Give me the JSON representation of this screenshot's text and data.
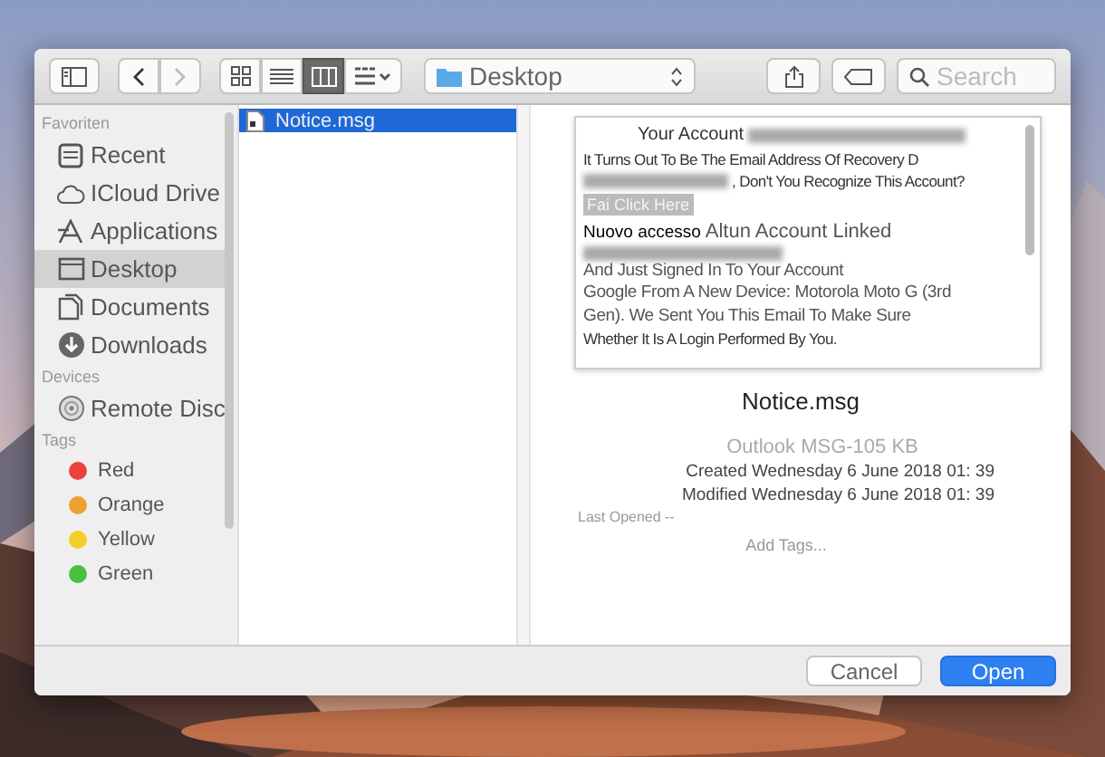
{
  "toolbar": {
    "views": [
      {
        "kind": "icons",
        "selected": false
      },
      {
        "kind": "list",
        "selected": false
      },
      {
        "kind": "columns",
        "selected": true
      },
      {
        "kind": "gallery",
        "selected": false
      }
    ],
    "location": "Desktop",
    "search": {
      "placeholder": "Search"
    }
  },
  "sidebar": {
    "sections": [
      {
        "title": "Favoriten",
        "items": [
          {
            "label": "Recent",
            "selected": false
          },
          {
            "label": "ICloud Drive",
            "selected": false
          },
          {
            "label": "Applications",
            "selected": false
          },
          {
            "label": "Desktop",
            "selected": true
          },
          {
            "label": "Documents",
            "selected": false
          },
          {
            "label": "Downloads",
            "selected": false
          }
        ]
      },
      {
        "title": "Devices",
        "items": [
          {
            "label": "Remote Disc",
            "selected": false
          }
        ]
      },
      {
        "title": "Tags",
        "items": [
          {
            "label": "Red",
            "color": "#e8413e",
            "selected": false
          },
          {
            "label": "Orange",
            "color": "#f0a030",
            "selected": false
          },
          {
            "label": "Yellow",
            "color": "#f3cf2b",
            "selected": false
          },
          {
            "label": "Green",
            "color": "#48c23e",
            "selected": false
          }
        ]
      }
    ]
  },
  "files": [
    {
      "name": "Notice.msg",
      "selected": true
    }
  ],
  "preview": {
    "lines": [
      {
        "kind": "redacted-after",
        "text": "Your Account"
      },
      {
        "kind": "small",
        "text": "It Turns Out To Be The Email Address Of Recovery D"
      },
      {
        "kind": "redacted-before",
        "text": ", Don't You Recognize This Account?"
      },
      {
        "kind": "link",
        "text": "Fai Click Here"
      },
      {
        "kind": "heading",
        "bold": "Nuovo accesso",
        "text": "Altun Account Linked"
      },
      {
        "kind": "redacted"
      },
      {
        "kind": "body",
        "text": "And Just Signed In To Your Account"
      },
      {
        "kind": "body",
        "text": "Google From A New Device: Motorola Moto G (3rd"
      },
      {
        "kind": "body",
        "text": "Gen). We Sent You This Email To Make Sure"
      },
      {
        "kind": "small",
        "text": "Whether It Is A Login Performed By You."
      }
    ],
    "filename": "Notice.msg",
    "type": "Outlook MSG-105 KB",
    "created": "Created Wednesday 6 June 2018 01: 39",
    "modified": "Modified Wednesday 6 June 2018 01: 39",
    "last_opened": "Last Opened --",
    "add_tags": "Add Tags..."
  },
  "buttons": [
    {
      "label": "Cancel",
      "kind": "secondary"
    },
    {
      "label": "Open",
      "kind": "primary"
    }
  ]
}
